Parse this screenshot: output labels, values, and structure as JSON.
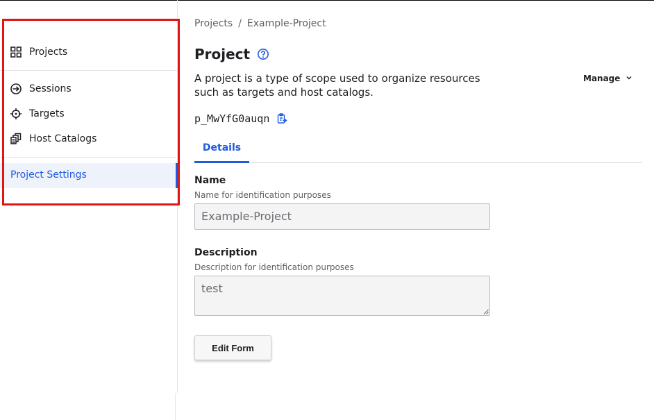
{
  "sidebar": {
    "items": [
      {
        "label": "Projects",
        "icon": "grid-icon"
      },
      {
        "label": "Sessions",
        "icon": "sessions-icon"
      },
      {
        "label": "Targets",
        "icon": "crosshair-icon"
      },
      {
        "label": "Host Catalogs",
        "icon": "host-catalogs-icon"
      }
    ],
    "active_item": "Project Settings"
  },
  "breadcrumb": {
    "items": [
      "Projects",
      "Example-Project"
    ],
    "separator": "/"
  },
  "header": {
    "title": "Project",
    "description": "A project is a type of scope used to organize resources such as targets and host catalogs.",
    "manage_label": "Manage",
    "project_id": "p_MwYfG0auqn"
  },
  "tabs": [
    {
      "label": "Details"
    }
  ],
  "form": {
    "name": {
      "label": "Name",
      "helper": "Name for identification purposes",
      "value": "Example-Project"
    },
    "description": {
      "label": "Description",
      "helper": "Description for identification purposes",
      "value": "test"
    },
    "edit_button": "Edit Form"
  },
  "colors": {
    "accent": "#1e5be0",
    "highlight": "#e01515",
    "active_bg": "#eef2fb"
  }
}
